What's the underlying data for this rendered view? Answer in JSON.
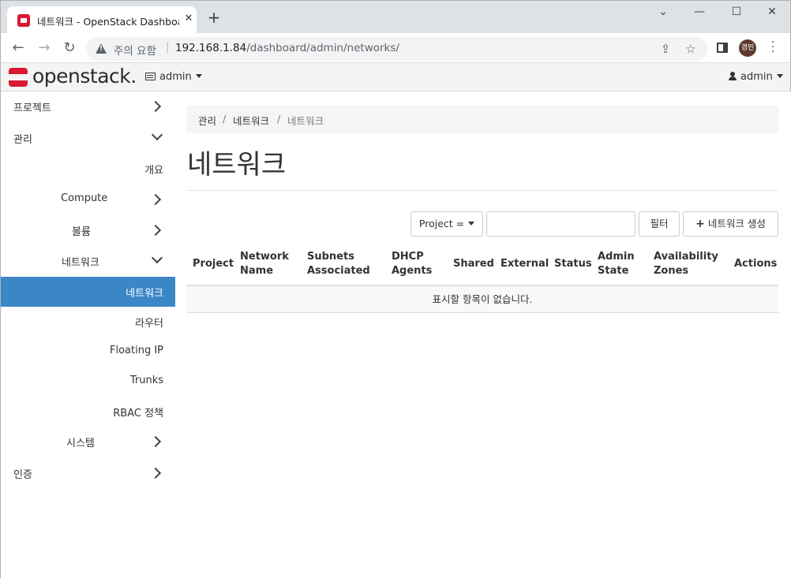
{
  "browser": {
    "tab_title": "네트워크 - OpenStack Dashboard",
    "tab_close": "✕",
    "new_tab": "+",
    "window_controls": {
      "minimize": "⌄",
      "min": "—",
      "max": "☐",
      "close": "✕"
    },
    "warning_text": "주의 요함",
    "url_host": "192.168.1.84",
    "url_path": "/dashboard/admin/networks/",
    "profile_initials": "경민"
  },
  "header": {
    "logo_text": "openstack.",
    "project": "admin",
    "user": "admin"
  },
  "sidebar": {
    "items": [
      {
        "label": "프로젝트"
      },
      {
        "label": "관리"
      },
      {
        "label": "개요"
      },
      {
        "label": "Compute"
      },
      {
        "label": "볼륨"
      },
      {
        "label": "네트워크"
      },
      {
        "label": "네트워크"
      },
      {
        "label": "라우터"
      },
      {
        "label": "Floating IP"
      },
      {
        "label": "Trunks"
      },
      {
        "label": "RBAC 정책"
      },
      {
        "label": "시스템"
      },
      {
        "label": "인증"
      }
    ]
  },
  "breadcrumb": [
    "관리",
    "네트워크",
    "네트워크"
  ],
  "page_title": "네트워크",
  "toolbar": {
    "filter_select": "Project =",
    "filter_input_value": "",
    "filter_button": "필터",
    "create_button": "네트워크 생성"
  },
  "table": {
    "columns": [
      [
        "Project",
        ""
      ],
      [
        "Network",
        "Name"
      ],
      [
        "Subnets",
        "Associated"
      ],
      [
        "DHCP",
        "Agents"
      ],
      [
        "Shared",
        ""
      ],
      [
        "External",
        ""
      ],
      [
        "Status",
        ""
      ],
      [
        "Admin",
        "State"
      ],
      [
        "Availability",
        "Zones"
      ],
      [
        "Actions",
        ""
      ]
    ],
    "empty_message": "표시할 항목이 없습니다."
  },
  "colors": {
    "active_nav": "#3b86c6",
    "brand_red": "#da1a32"
  }
}
